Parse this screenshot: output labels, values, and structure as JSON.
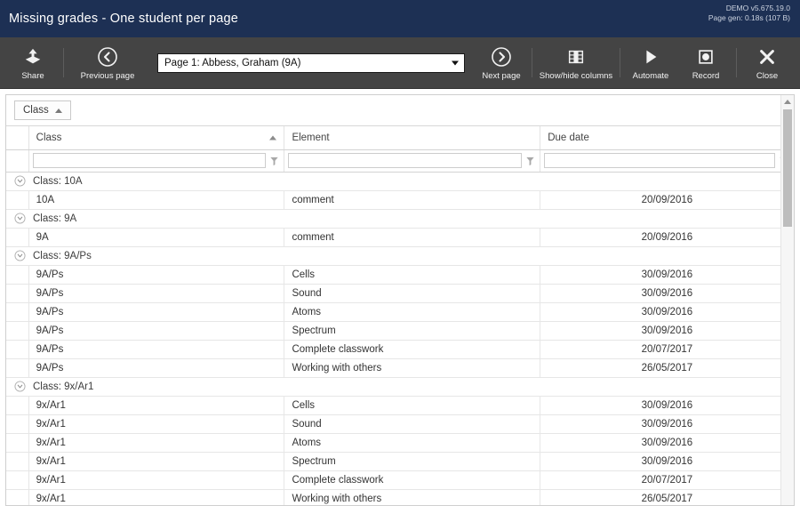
{
  "titlebar": {
    "title": "Missing grades - One student per page",
    "version": "DEMO v5.675.19.0",
    "pagegen": "Page gen: 0.18s (107 B)"
  },
  "toolbar": {
    "share_label": "Share",
    "prev_label": "Previous page",
    "next_label": "Next page",
    "columns_label": "Show/hide columns",
    "automate_label": "Automate",
    "record_label": "Record",
    "close_label": "Close",
    "page_select_value": "Page 1: Abbess, Graham (9A)"
  },
  "groupbar": {
    "chip_label": "Class"
  },
  "grid": {
    "columns": [
      {
        "label": "Class",
        "sorted": "asc"
      },
      {
        "label": "Element",
        "sorted": ""
      },
      {
        "label": "Due date",
        "sorted": ""
      }
    ],
    "filters": [
      {
        "value": "",
        "placeholder": ""
      },
      {
        "value": "",
        "placeholder": ""
      },
      {
        "value": "",
        "placeholder": ""
      }
    ],
    "groups": [
      {
        "label": "Class: 10A",
        "rows": [
          {
            "class": "10A",
            "element": "comment",
            "due": "20/09/2016"
          }
        ]
      },
      {
        "label": "Class: 9A",
        "rows": [
          {
            "class": "9A",
            "element": "comment",
            "due": "20/09/2016"
          }
        ]
      },
      {
        "label": "Class: 9A/Ps",
        "rows": [
          {
            "class": "9A/Ps",
            "element": "Cells",
            "due": "30/09/2016"
          },
          {
            "class": "9A/Ps",
            "element": "Sound",
            "due": "30/09/2016"
          },
          {
            "class": "9A/Ps",
            "element": "Atoms",
            "due": "30/09/2016"
          },
          {
            "class": "9A/Ps",
            "element": "Spectrum",
            "due": "30/09/2016"
          },
          {
            "class": "9A/Ps",
            "element": "Complete classwork",
            "due": "20/07/2017"
          },
          {
            "class": "9A/Ps",
            "element": "Working with others",
            "due": "26/05/2017"
          }
        ]
      },
      {
        "label": "Class: 9x/Ar1",
        "rows": [
          {
            "class": "9x/Ar1",
            "element": "Cells",
            "due": "30/09/2016"
          },
          {
            "class": "9x/Ar1",
            "element": "Sound",
            "due": "30/09/2016"
          },
          {
            "class": "9x/Ar1",
            "element": "Atoms",
            "due": "30/09/2016"
          },
          {
            "class": "9x/Ar1",
            "element": "Spectrum",
            "due": "30/09/2016"
          },
          {
            "class": "9x/Ar1",
            "element": "Complete classwork",
            "due": "20/07/2017"
          },
          {
            "class": "9x/Ar1",
            "element": "Working with others",
            "due": "26/05/2017"
          }
        ]
      }
    ]
  },
  "colors": {
    "titlebar_bg": "#1d3054",
    "toolbar_bg": "#444444",
    "panel_bg": "#ffffff",
    "grid_line": "#e6e6e6",
    "scroll_thumb": "#bdbdbd"
  }
}
